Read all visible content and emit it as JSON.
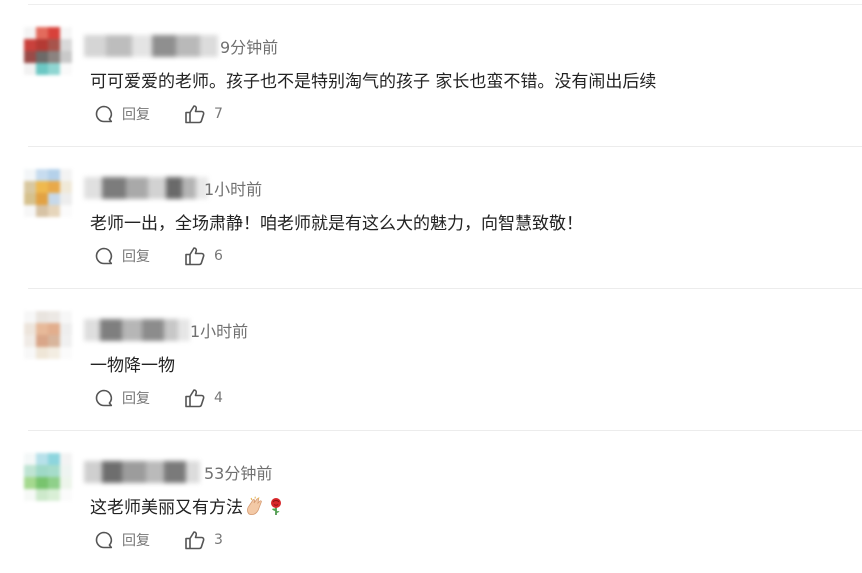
{
  "comments": [
    {
      "time": "9分钟前",
      "text": "可可爱爱的老师。孩子也不是特别淘气的孩子 家长也蛮不错。没有闹出后续",
      "reply_label": "回复",
      "likes": "7"
    },
    {
      "time": "1小时前",
      "text": "老师一出，全场肃静！咱老师就是有这么大的魅力，向智慧致敬！",
      "reply_label": "回复",
      "likes": "6"
    },
    {
      "time": "1小时前",
      "text": "一物降一物",
      "reply_label": "回复",
      "likes": "4"
    },
    {
      "time": "53分钟前",
      "text": "这老师美丽又有方法",
      "emojis": [
        "clapping-hands-emoji",
        "rose-emoji"
      ],
      "reply_label": "回复",
      "likes": "3"
    }
  ],
  "icons": {
    "reply": "comment-bubble-icon",
    "like": "thumbs-up-icon"
  },
  "colors": {
    "text": "#222222",
    "meta": "#707070",
    "action": "#777777",
    "divider": "#ececec"
  }
}
